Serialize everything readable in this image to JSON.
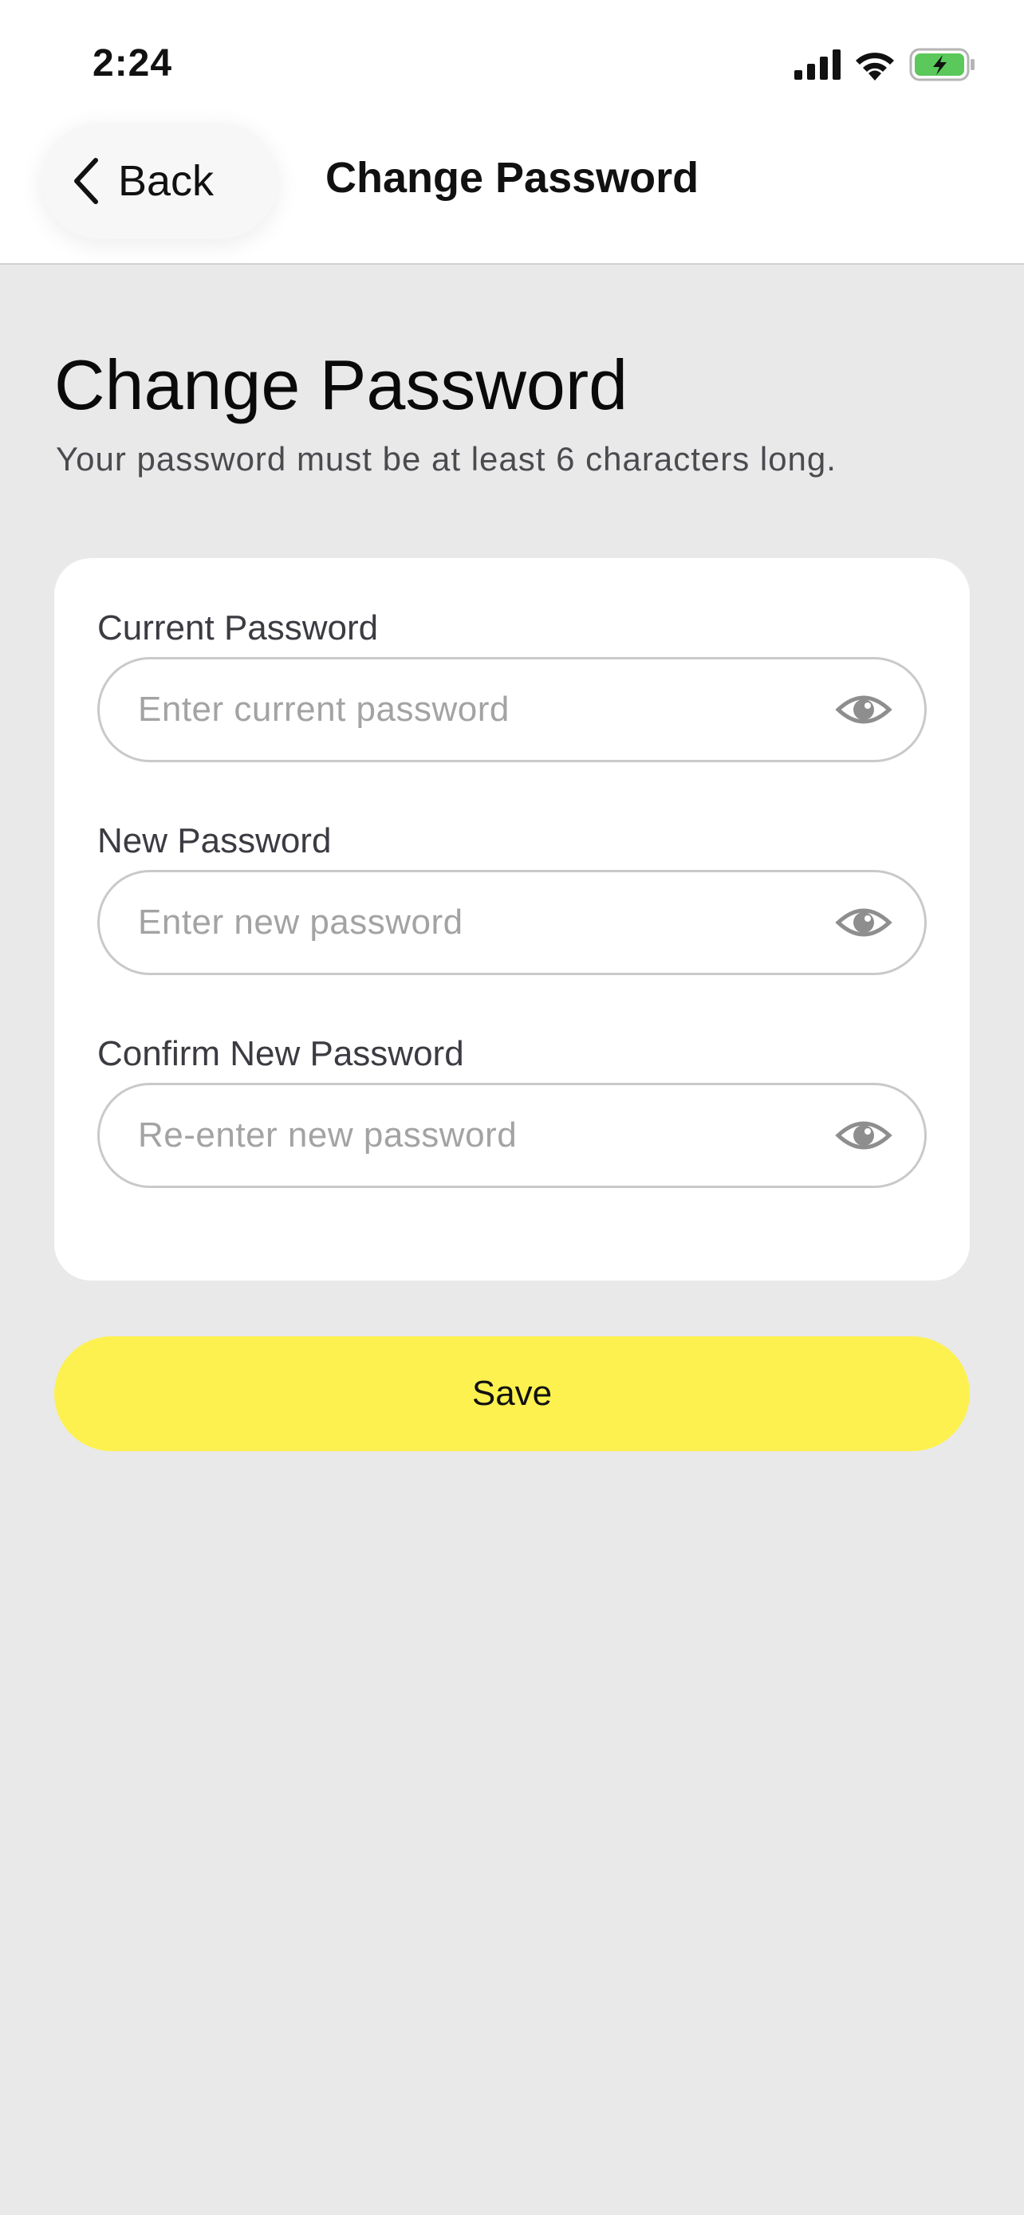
{
  "status_bar": {
    "time": "2:24",
    "icons": [
      "cellular-signal-icon",
      "wifi-icon",
      "battery-charging-icon"
    ],
    "battery_color": "#5ac85a"
  },
  "nav": {
    "back_label": "Back",
    "title": "Change Password"
  },
  "page": {
    "heading": "Change Password",
    "subtitle": "Your password must be at least 6 characters long."
  },
  "form": {
    "fields": [
      {
        "label": "Current Password",
        "placeholder": "Enter current password",
        "value": ""
      },
      {
        "label": "New Password",
        "placeholder": "Enter new password",
        "value": ""
      },
      {
        "label": "Confirm New Password",
        "placeholder": "Re-enter new password",
        "value": ""
      }
    ]
  },
  "save_label": "Save",
  "colors": {
    "background": "#e9e9e9",
    "card": "#ffffff",
    "accent": "#fdf14f",
    "label": "#3b3b42",
    "placeholder": "#a3a3a3"
  }
}
